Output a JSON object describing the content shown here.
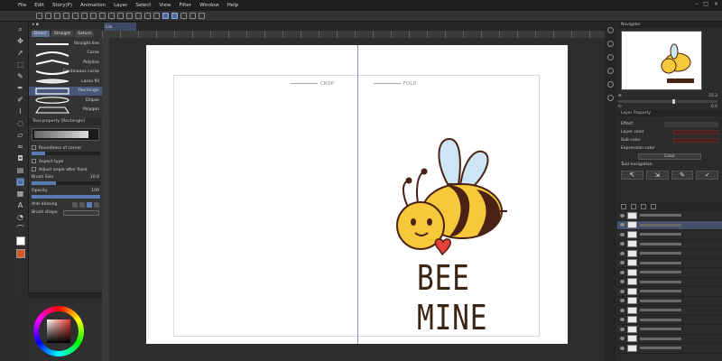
{
  "menu": {
    "items": [
      "File",
      "Edit",
      "Story(P)",
      "Animation",
      "Layer",
      "Select",
      "View",
      "Filter",
      "Window",
      "Help"
    ]
  },
  "subtool": {
    "tabs": [
      "Direct",
      "Straight",
      "Saturn"
    ],
    "shapes": [
      "Straight line",
      "Curve",
      "Polyline",
      "Continuous curve",
      "Lasso fill",
      "Rectangle",
      "Ellipse",
      "Polygon"
    ],
    "selected_shape": "Rectangle",
    "section_title": "Tool property [Rectangle]",
    "roundness_label": "Roundness of corner",
    "aspect_label": "Aspect type",
    "adjust_label": "Adjust angle after fixed",
    "brush_size_label": "Brush Size",
    "brush_size_value": "10.0",
    "opacity_label": "Opacity",
    "opacity_value": "100",
    "antialias_label": "Anti-aliasing",
    "brush_shape_label": "Brush shape"
  },
  "document": {
    "tab_label": "Lila card_bigbee"
  },
  "paper": {
    "crop_label": "CROP",
    "fold_label": "FOLD",
    "headline": "BEE MINE"
  },
  "right": {
    "navigator_title": "Navigator",
    "zoom_value": "33.3",
    "rotate_value": "0.0",
    "layer_property_title": "Layer Property",
    "effect_label": "Effect",
    "layer_color_label": "Layer color",
    "sub_color_label": "Sub color",
    "expression_label": "Expression color",
    "expression_value": "Color",
    "tool_nav_label": "Tool navigation"
  },
  "colors": {
    "accent": "#5a7ab3",
    "bee_yellow": "#f6c83a",
    "bee_brown": "#4a2214",
    "wing_blue": "#cde6f6",
    "heart_red": "#e5403a",
    "current_color": "#d9582b"
  }
}
